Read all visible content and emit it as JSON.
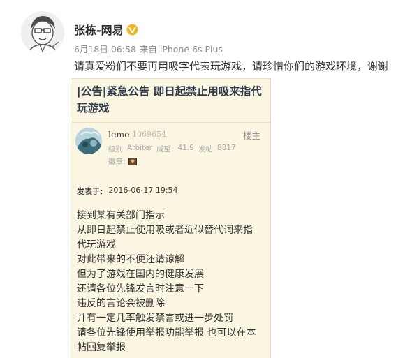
{
  "post": {
    "author": "张栋-网易",
    "date": "6月18日 06:58",
    "source": "来自 iPhone 6s Plus",
    "text": "请真爱粉们不要再用吸字代表玩游戏，请珍惜你们的游戏环境，谢谢"
  },
  "card": {
    "title": "|公告|紧急公告 即日起禁止用吸来指代玩游戏",
    "username": "leme",
    "user_id": "1069654",
    "floor": "楼主",
    "stats": {
      "level_label": "级别",
      "level": "Arbiter",
      "prestige_label": "威望:",
      "prestige": "41.9",
      "posts_label": "发帖",
      "posts": "8817"
    },
    "medal_label": "徽章:",
    "posted_label": "发表于:",
    "posted_time": "2016-06-17 19:54",
    "lines": [
      "接到某有关部门指示",
      "从即日起禁止使用吸或者近似替代词来指",
      "代玩游戏",
      "对此带来的不便还请谅解",
      "但为了游戏在国内的健康发展",
      "还请各位先锋发言时注意一下",
      "违反的言论会被删除",
      "并有一定几率触发禁言或进一步处罚",
      "请各位先锋使用举报功能举报 也可以在本",
      "帖回复举报"
    ]
  },
  "colors": {
    "card_bg": "#fbf6e2",
    "verified_badge": "#f3b51b",
    "meta_text": "#8a8a8a"
  },
  "icons": [
    "author-avatar",
    "verified-badge-icon",
    "user-avatar",
    "medal-icon"
  ]
}
